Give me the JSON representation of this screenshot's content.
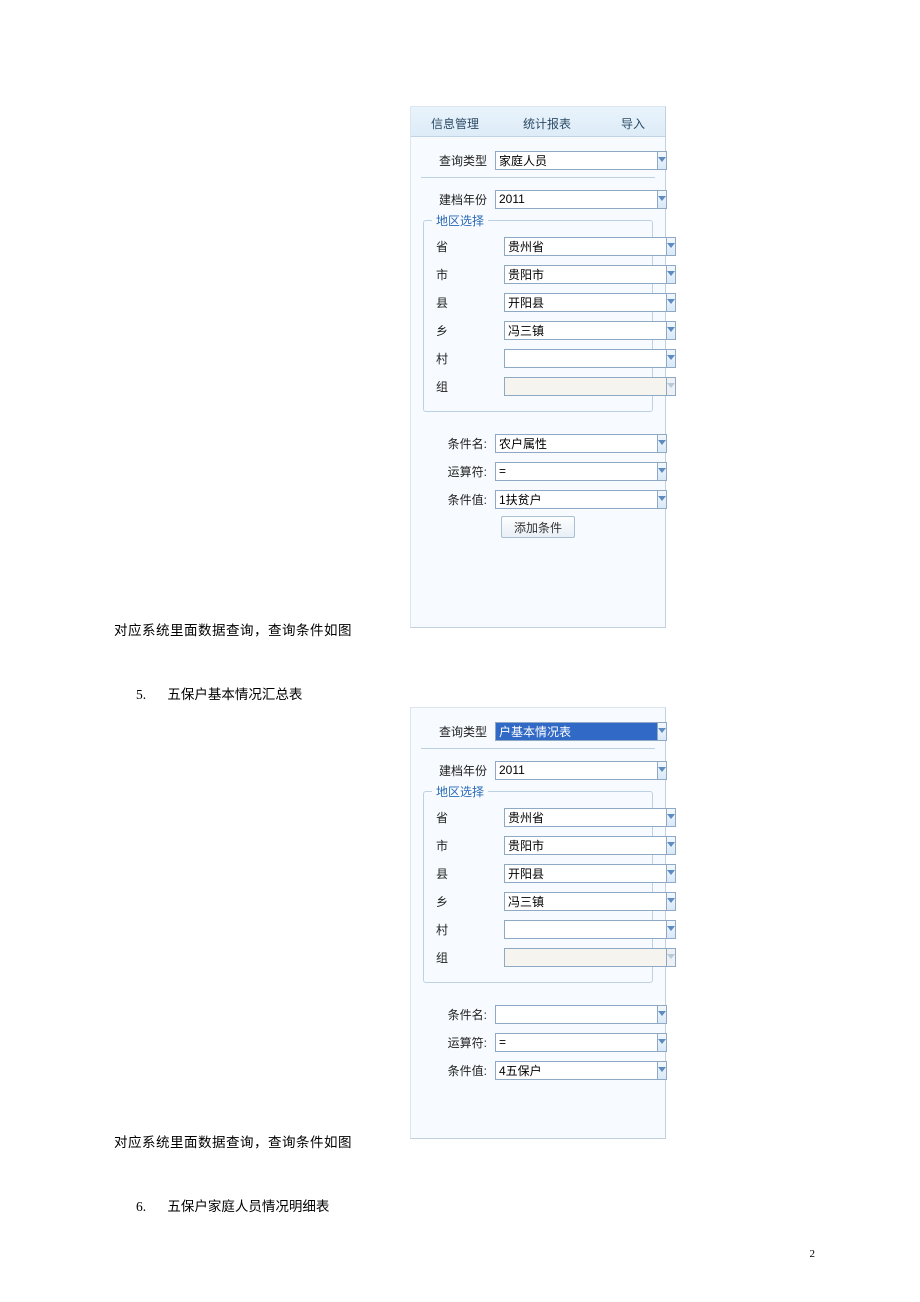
{
  "page_number": "2",
  "captions": {
    "c1": "对应系统里面数据查询，查询条件如图",
    "c2": "对应系统里面数据查询，查询条件如图"
  },
  "list": {
    "item5": {
      "num": "5.",
      "text": "五保户基本情况汇总表"
    },
    "item6": {
      "num": "6.",
      "text": "五保户家庭人员情况明细表"
    }
  },
  "panel1": {
    "tabs": {
      "t1": "信息管理",
      "t2": "统计报表",
      "t3": "导入"
    },
    "query_type": {
      "label": "查询类型",
      "value": "家庭人员"
    },
    "year": {
      "label": "建档年份",
      "value": "2011"
    },
    "region_title": "地区选择",
    "region": {
      "province": {
        "label": "省",
        "value": "贵州省"
      },
      "city": {
        "label": "市",
        "value": "贵阳市"
      },
      "county": {
        "label": "县",
        "value": "开阳县"
      },
      "town": {
        "label": "乡",
        "value": "冯三镇"
      },
      "village": {
        "label": "村",
        "value": ""
      },
      "group": {
        "label": "组",
        "value": ""
      }
    },
    "cond": {
      "name": {
        "label": "条件名:",
        "value": "农户属性"
      },
      "op": {
        "label": "运算符:",
        "value": "="
      },
      "val": {
        "label": "条件值:",
        "value": "1扶贫户"
      }
    },
    "add_btn": "添加条件"
  },
  "panel2": {
    "query_type": {
      "label": "查询类型",
      "value": "户基本情况表"
    },
    "year": {
      "label": "建档年份",
      "value": "2011"
    },
    "region_title": "地区选择",
    "region": {
      "province": {
        "label": "省",
        "value": "贵州省"
      },
      "city": {
        "label": "市",
        "value": "贵阳市"
      },
      "county": {
        "label": "县",
        "value": "开阳县"
      },
      "town": {
        "label": "乡",
        "value": "冯三镇"
      },
      "village": {
        "label": "村",
        "value": ""
      },
      "group": {
        "label": "组",
        "value": ""
      }
    },
    "cond": {
      "name": {
        "label": "条件名:",
        "value": ""
      },
      "op": {
        "label": "运算符:",
        "value": "="
      },
      "val": {
        "label": "条件值:",
        "value": "4五保户"
      }
    }
  }
}
